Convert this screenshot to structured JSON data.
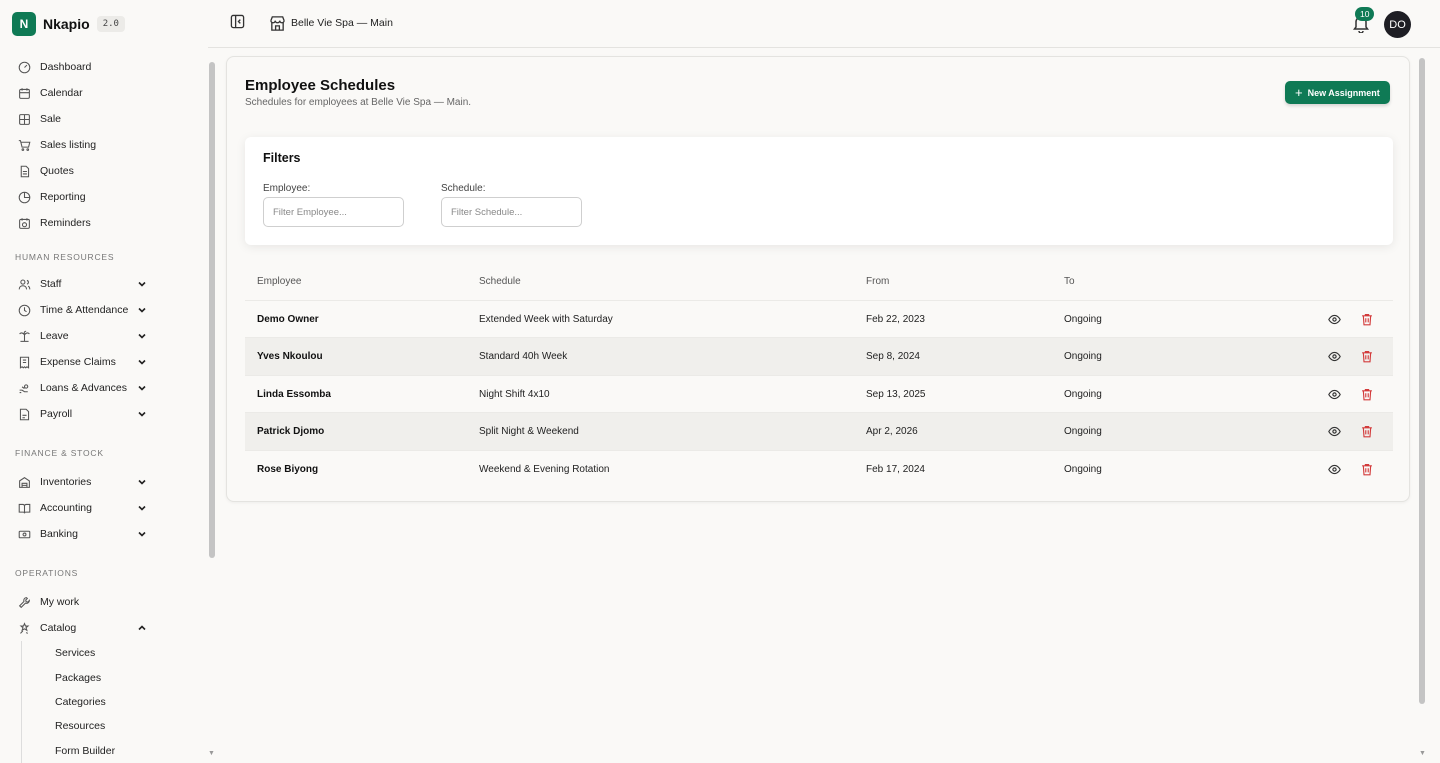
{
  "app": {
    "name": "Nkapio",
    "version": "2.0",
    "logo_letter": "N",
    "brand_color": "#0f7a55"
  },
  "topbar": {
    "store": "Belle Vie Spa — Main",
    "notifications": "10",
    "avatar": "DO"
  },
  "sidebar": {
    "main": [
      {
        "label": "Dashboard",
        "icon": "dashboard-icon"
      },
      {
        "label": "Calendar",
        "icon": "calendar-icon"
      },
      {
        "label": "Sale",
        "icon": "sale-icon"
      },
      {
        "label": "Sales listing",
        "icon": "cart-icon"
      },
      {
        "label": "Quotes",
        "icon": "document-icon"
      },
      {
        "label": "Reporting",
        "icon": "pie-chart-icon"
      },
      {
        "label": "Reminders",
        "icon": "reminder-icon"
      }
    ],
    "hr_title": "Human Resources",
    "hr": [
      {
        "label": "Staff",
        "icon": "users-icon"
      },
      {
        "label": "Time & Attendance",
        "icon": "clock-icon"
      },
      {
        "label": "Leave",
        "icon": "palm-icon"
      },
      {
        "label": "Expense Claims",
        "icon": "receipt-icon"
      },
      {
        "label": "Loans & Advances",
        "icon": "money-icon"
      },
      {
        "label": "Payroll",
        "icon": "payroll-icon"
      }
    ],
    "finance_title": "Finance & Stock",
    "finance": [
      {
        "label": "Inventories",
        "icon": "warehouse-icon"
      },
      {
        "label": "Accounting",
        "icon": "book-icon"
      },
      {
        "label": "Banking",
        "icon": "banknote-icon"
      }
    ],
    "ops_title": "Operations",
    "ops": [
      {
        "label": "My work",
        "icon": "wrench-icon"
      },
      {
        "label": "Catalog",
        "icon": "catalog-icon"
      }
    ],
    "catalog_items": [
      "Services",
      "Packages",
      "Categories",
      "Resources",
      "Form Builder"
    ]
  },
  "page": {
    "title": "Employee Schedules",
    "subtitle": "Schedules for employees at Belle Vie Spa — Main.",
    "new_button": "New Assignment"
  },
  "filters": {
    "title": "Filters",
    "employee_label": "Employee:",
    "employee_placeholder": "Filter Employee...",
    "schedule_label": "Schedule:",
    "schedule_placeholder": "Filter Schedule..."
  },
  "table": {
    "headers": [
      "Employee",
      "Schedule",
      "From",
      "To"
    ],
    "rows": [
      {
        "employee": "Demo Owner",
        "schedule": "Extended Week with Saturday",
        "from": "Feb 22, 2023",
        "to": "Ongoing"
      },
      {
        "employee": "Yves Nkoulou",
        "schedule": "Standard 40h Week",
        "from": "Sep 8, 2024",
        "to": "Ongoing"
      },
      {
        "employee": "Linda Essomba",
        "schedule": "Night Shift 4x10",
        "from": "Sep 13, 2025",
        "to": "Ongoing"
      },
      {
        "employee": "Patrick Djomo",
        "schedule": "Split Night & Weekend",
        "from": "Apr 2, 2026",
        "to": "Ongoing"
      },
      {
        "employee": "Rose Biyong",
        "schedule": "Weekend & Evening Rotation",
        "from": "Feb 17, 2024",
        "to": "Ongoing"
      }
    ]
  }
}
